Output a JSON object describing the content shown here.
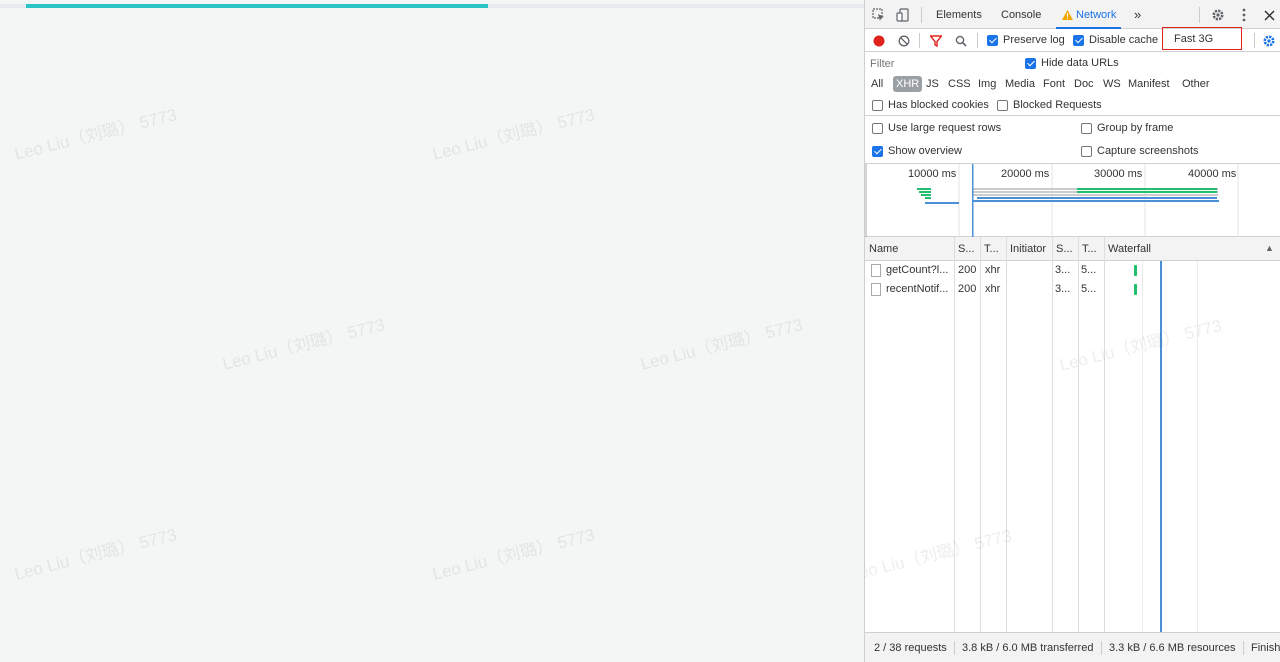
{
  "page": {
    "progress": 0.535,
    "watermark": "Leo Liu（刘璐） 5773",
    "accent": "#2bc4c4"
  },
  "devtools": {
    "tabs": [
      {
        "label": "Elements"
      },
      {
        "label": "Console"
      },
      {
        "label": "Network"
      }
    ],
    "more_tabs": "»",
    "toolbar": {
      "preserve_log": "Preserve log",
      "disable_cache": "Disable cache",
      "throttling": "Fast 3G",
      "record_color": "#e0231c",
      "filter_color": "#e0231c"
    },
    "filter": {
      "placeholder": "Filter",
      "hide_data_urls": "Hide data URLs",
      "types": [
        "All",
        "XHR",
        "JS",
        "CSS",
        "Img",
        "Media",
        "Font",
        "Doc",
        "WS",
        "Manifest",
        "Other"
      ],
      "selected_type": "XHR",
      "has_blocked_cookies": "Has blocked cookies",
      "blocked_requests": "Blocked Requests"
    },
    "options": {
      "use_large_rows": "Use large request rows",
      "group_by_frame": "Group by frame",
      "show_overview": "Show overview",
      "capture_screenshots": "Capture screenshots"
    },
    "overview": {
      "ticks": [
        "10000 ms",
        "20000 ms",
        "30000 ms",
        "40000 ms"
      ]
    },
    "grid": {
      "columns": [
        "Name",
        "S...",
        "T...",
        "Initiator",
        "S...",
        "T...",
        "Waterfall"
      ],
      "sort_icon": "▲",
      "rows": [
        {
          "name": "getCount?l...",
          "status": "200",
          "type": "xhr",
          "initiator": "",
          "size": "3...",
          "time": "5..."
        },
        {
          "name": "recentNotif...",
          "status": "200",
          "type": "xhr",
          "initiator": "",
          "size": "3...",
          "time": "5..."
        }
      ]
    },
    "status": {
      "requests": "2 / 38 requests",
      "transferred": "3.8 kB / 6.0 MB transferred",
      "resources": "3.3 kB / 6.6 MB resources",
      "finish": "Finish"
    }
  }
}
